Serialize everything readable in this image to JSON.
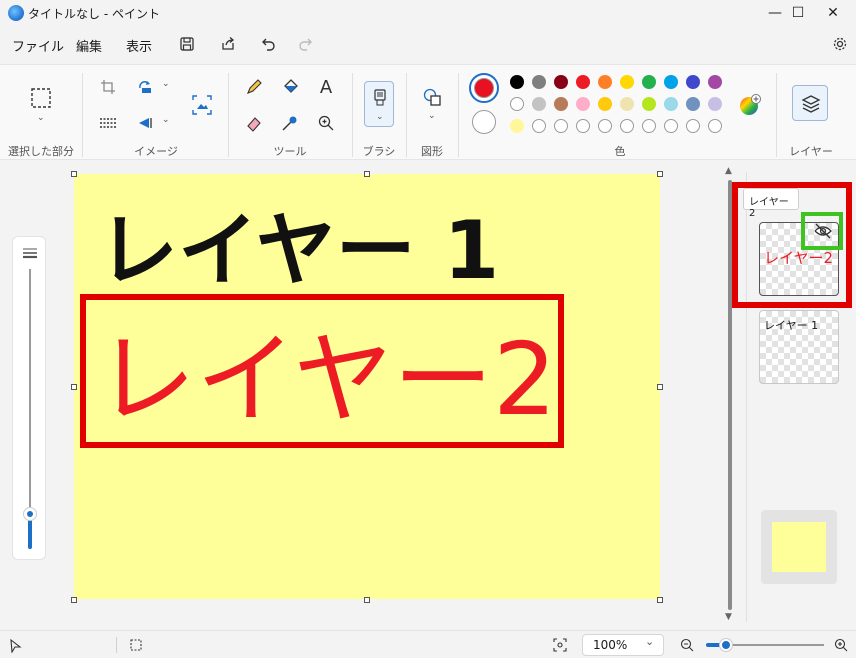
{
  "window": {
    "title": "タイトルなし - ペイント",
    "minimize": "—",
    "maximize": "☐",
    "close": "✕"
  },
  "menu": {
    "file": "ファイル",
    "edit": "編集",
    "view": "表示"
  },
  "ribbon": {
    "groups": {
      "selection": "選択した部分",
      "image": "イメージ",
      "tools": "ツール",
      "brush": "ブラシ",
      "shapes": "図形",
      "colors": "色",
      "layers": "レイヤー"
    },
    "primary_color": "#e81123",
    "palette_row1": [
      "#000000",
      "#7f7f7f",
      "#880015",
      "#ed1c24",
      "#ff7f27",
      "#ffd800",
      "#22b14c",
      "#00a2e8",
      "#3f48cc",
      "#a349a4"
    ],
    "palette_row2": [
      "#ffffff",
      "#c3c3c3",
      "#b97a57",
      "#ffaec9",
      "#ffc90e",
      "#efe4b0",
      "#b5e61d",
      "#99d9ea",
      "#7092be",
      "#c8bfe7"
    ],
    "palette_row3": [
      "#fff799"
    ]
  },
  "canvas": {
    "background": "#ffff99",
    "layer1_text": "レイヤー 1",
    "layer2_text": "レイヤー2"
  },
  "layers_panel": {
    "tooltip": "レイヤー 2",
    "layer2_thumb_text": "レイヤー2",
    "layer1_thumb_text": "レイヤー 1",
    "visibility_icon": "eye-slash-icon"
  },
  "status": {
    "zoom": "100%"
  }
}
